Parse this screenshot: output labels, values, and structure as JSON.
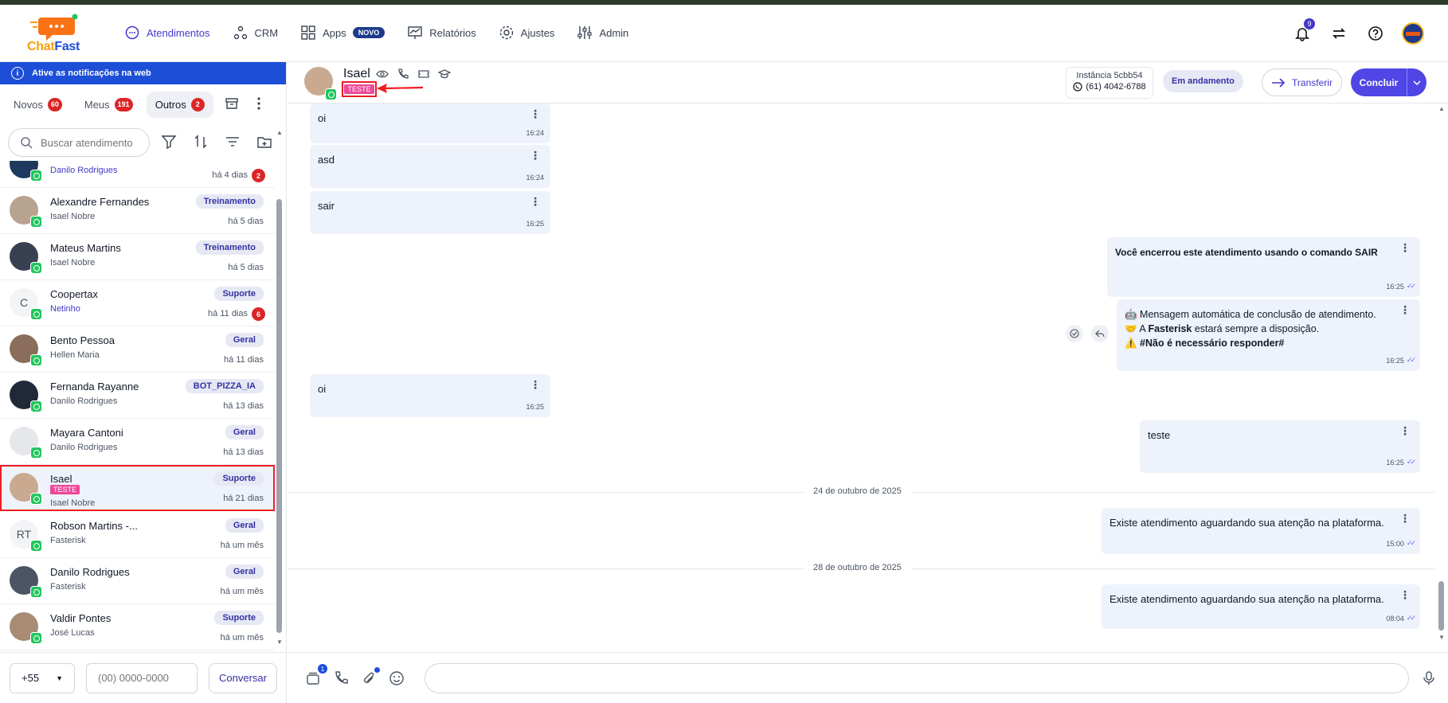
{
  "brand": {
    "logo_text_a": "Chat",
    "logo_text_b": "Fast"
  },
  "nav": [
    {
      "label": "Atendimentos",
      "icon": "chat-bubble-icon",
      "active": true
    },
    {
      "label": "CRM",
      "icon": "nodes-icon"
    },
    {
      "label": "Apps",
      "icon": "grid-icon",
      "badge": "NOVO"
    },
    {
      "label": "Relatórios",
      "icon": "chart-icon"
    },
    {
      "label": "Ajustes",
      "icon": "gear-icon"
    },
    {
      "label": "Admin",
      "icon": "sliders-icon"
    }
  ],
  "header_right": {
    "notifications_count": "9"
  },
  "notification_bar": {
    "text": "Ative as notificações na web"
  },
  "tabs": [
    {
      "label": "Novos",
      "count": "60"
    },
    {
      "label": "Meus",
      "count": "191"
    },
    {
      "label": "Outros",
      "count": "2",
      "active": true
    }
  ],
  "search": {
    "placeholder": "Buscar atendimento"
  },
  "conversations": [
    {
      "name": "",
      "sub": "Danilo Rodrigues",
      "sub_blue": true,
      "tag": "",
      "time": "há 4 dias",
      "count": "2"
    },
    {
      "name": "Alexandre Fernandes",
      "sub": "Isael Nobre",
      "tag": "Treinamento",
      "time": "há 5 dias"
    },
    {
      "name": "Mateus Martins",
      "sub": "Isael Nobre",
      "tag": "Treinamento",
      "time": "há 5 dias"
    },
    {
      "name": "Coopertax",
      "sub": "Netinho",
      "sub_blue": true,
      "tag": "Suporte",
      "time": "há 11 dias",
      "count": "6",
      "initials": "C"
    },
    {
      "name": "Bento Pessoa",
      "sub": "Hellen Maria",
      "tag": "Geral",
      "time": "há 11 dias"
    },
    {
      "name": "Fernanda Rayanne",
      "sub": "Danilo Rodrigues",
      "tag": "BOT_PIZZA_IA",
      "time": "há 13 dias"
    },
    {
      "name": "Mayara Cantoni",
      "sub": "Danilo Rodrigues",
      "tag": "Geral",
      "time": "há 13 dias"
    },
    {
      "name": "Isael",
      "sub": "Isael Nobre",
      "tag": "Suporte",
      "time": "há 21 dias",
      "label": "TESTE",
      "selected": true
    },
    {
      "name": "Robson Martins -...",
      "sub": "Fasterisk",
      "tag": "Geral",
      "time": "há um mês",
      "initials": "RT"
    },
    {
      "name": "Danilo Rodrigues",
      "sub": "Fasterisk",
      "tag": "Geral",
      "time": "há um mês"
    },
    {
      "name": "Valdir Pontes",
      "sub": "José Lucas",
      "tag": "Suporte",
      "time": "há um mês"
    }
  ],
  "footer": {
    "country_code": "+55",
    "phone_placeholder": "(00) 0000-0000",
    "start_label": "Conversar"
  },
  "chat": {
    "name": "Isael",
    "label": "TESTE",
    "instance_label": "Instância 5cbb54",
    "instance_phone": "(61) 4042-6788",
    "status": "Em andamento",
    "transfer_label": "Transferir",
    "conclude_label": "Concluir",
    "messages": [
      {
        "text": "oi",
        "time": "16:24"
      },
      {
        "text": "asd",
        "time": "16:24"
      },
      {
        "text": "sair",
        "time": "16:25"
      },
      {
        "text": "Você encerrou este atendimento usando o comando SAIR",
        "time": "16:25"
      },
      {
        "line1": "🤖 Mensagem automática de conclusão de atendimento.",
        "line2_a": "🤝 A ",
        "line2_b": "Fasterisk",
        "line2_c": " estará sempre a disposição.",
        "line3_a": "⚠️ ",
        "line3_b": "#Não é necessário responder#",
        "time": "16:25"
      },
      {
        "text": "oi",
        "time": "16:25"
      },
      {
        "text": "teste",
        "time": "16:25"
      },
      {
        "text": "Existe atendimento aguardando sua atenção na plataforma.",
        "time": "15:00"
      },
      {
        "text": "Existe atendimento aguardando sua atenção na plataforma.",
        "time": "08:04"
      }
    ],
    "date_separators": [
      "24 de outubro de 2025",
      "28 de outubro de 2025"
    ],
    "composer_badge": "1"
  }
}
